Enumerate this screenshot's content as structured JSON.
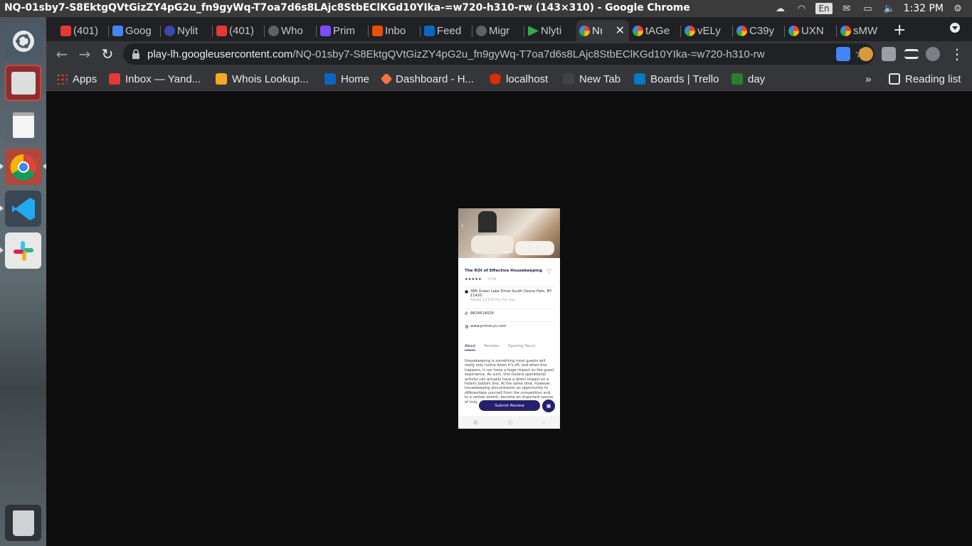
{
  "window": {
    "title": "NQ-01sby7-S8EktgQVtGizZY4pG2u_fn9gyWq-T7oa7d6s8LAjc8StbEClKGd10YIka-=w720-h310-rw (143×310) - Google Chrome"
  },
  "tray": {
    "keyboard": "En",
    "clock": "1:32 PM"
  },
  "tabs": [
    {
      "label": "(401)",
      "color": "#e53935"
    },
    {
      "label": "Goog",
      "color": "#4285f4"
    },
    {
      "label": "Nylit",
      "color": "#3949ab"
    },
    {
      "label": "(401)",
      "color": "#e53935"
    },
    {
      "label": "Who",
      "color": "#616161"
    },
    {
      "label": "Prim",
      "color": "#7c4dff"
    },
    {
      "label": "Inbo",
      "color": "#e65100"
    },
    {
      "label": "Feed",
      "color": "#0a66c2"
    },
    {
      "label": "Migr",
      "color": "#616161"
    },
    {
      "label": "Nlyti",
      "color": "#34a853"
    },
    {
      "label": "Nı",
      "color": "#fbbc05",
      "active": true
    },
    {
      "label": "tAGe",
      "color": "#34a853"
    },
    {
      "label": "vELy",
      "color": "#34a853"
    },
    {
      "label": "C39y",
      "color": "#34a853"
    },
    {
      "label": "UXN",
      "color": "#34a853"
    },
    {
      "label": "sMW",
      "color": "#34a853"
    }
  ],
  "address": {
    "host": "play-lh.googleusercontent.com",
    "path": "/NQ-01sby7-S8EktgQVtGizZY4pG2u_fn9gyWq-T7oa7d6s8LAjc8StbEClKGd10YIka-=w720-h310-rw"
  },
  "bookmarks": [
    {
      "label": "Apps",
      "color": "#ea4335"
    },
    {
      "label": "Inbox — Yand...",
      "color": "#e53935"
    },
    {
      "label": "Whois Lookup...",
      "color": "#f9a825"
    },
    {
      "label": "Home",
      "color": "#0a66c2"
    },
    {
      "label": "Dashboard - H...",
      "color": "#ff7043"
    },
    {
      "label": "localhost",
      "color": "#dd2c00"
    },
    {
      "label": "New Tab",
      "color": "#424242"
    },
    {
      "label": "Boards | Trello",
      "color": "#0079bf"
    },
    {
      "label": "day",
      "color": "#2e7d32"
    }
  ],
  "bookmarks_overflow": "»",
  "reading_list": "Reading list",
  "app": {
    "title": "The ROI of Effective Housekeeping",
    "stars": "★★★★★",
    "rating": "4.38",
    "address_line": "386 Green Lake Drive South Ozone Park, NY 11420",
    "distance": "About 12120 km for you",
    "phone": "9824614026",
    "website": "www.primocys.com",
    "tabs": [
      "About",
      "Reviews",
      "Opening Hours"
    ],
    "about": "Housekeeping is something most guests will really only notice when it's off, and when this happens, it can have a huge impact on the guest experience. As such, this routine operational activity can actually have a direct impact on a hotel's bottom line. At the same time, however, housekeeping also presents an opportunity to differentiate yourself from the competition and, to a certain extent, become an important source of truly",
    "submit_label": "Submit Review"
  }
}
